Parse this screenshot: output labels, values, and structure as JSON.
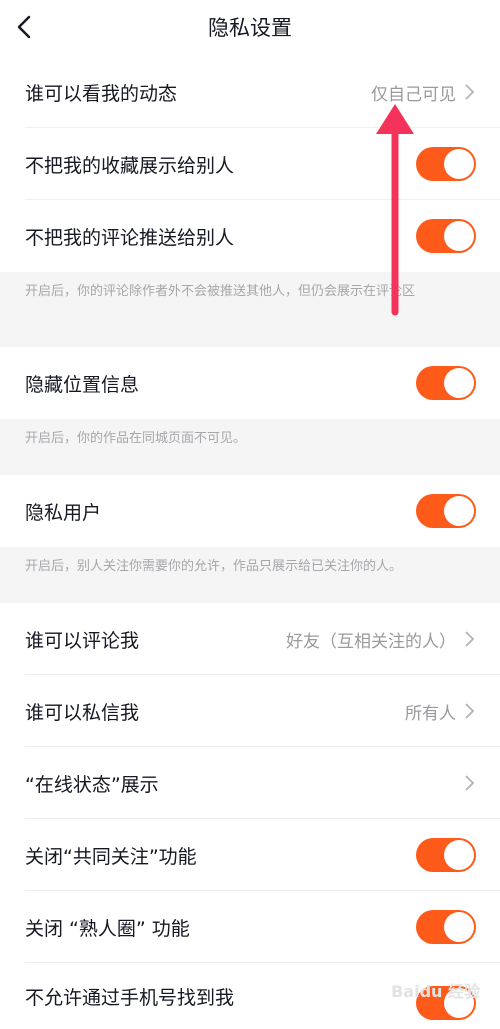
{
  "header": {
    "title": "隐私设置",
    "back_icon": "chevron-left-icon"
  },
  "rows": {
    "who_can_see": {
      "label": "谁可以看我的动态",
      "value": "仅自己可见"
    },
    "hide_favorites": {
      "label": "不把我的收藏展示给别人",
      "on": true
    },
    "hide_comments": {
      "label": "不把我的评论推送给别人",
      "on": true
    },
    "hide_location": {
      "label": "隐藏位置信息",
      "on": true
    },
    "private_user": {
      "label": "隐私用户",
      "on": true
    },
    "who_can_comment": {
      "label": "谁可以评论我",
      "value": "好友（互相关注的人）"
    },
    "who_can_message": {
      "label": "谁可以私信我",
      "value": "所有人"
    },
    "online_status": {
      "label": "“在线状态”展示",
      "value": ""
    },
    "close_mutual": {
      "label": "关闭“共同关注”功能",
      "on": true
    },
    "close_acquaintance": {
      "label": "关闭 “熟人圈” 功能",
      "on": true
    },
    "no_phone_find": {
      "label": "不允许通过手机号找到我",
      "on": true
    }
  },
  "notes": {
    "comments": "开启后，你的评论除作者外不会被推送其他人，但仍会展示在评论区",
    "location": "开启后，你的作品在同城页面不可见。",
    "private": "开启后，别人关注你需要你的允许，作品只展示给已关注你的人。"
  },
  "watermark": "Baidu 经验",
  "colors": {
    "toggle_on": "#fe5a1a",
    "annotation_arrow": "#f4335a",
    "note_bg": "#f5f5f5"
  }
}
